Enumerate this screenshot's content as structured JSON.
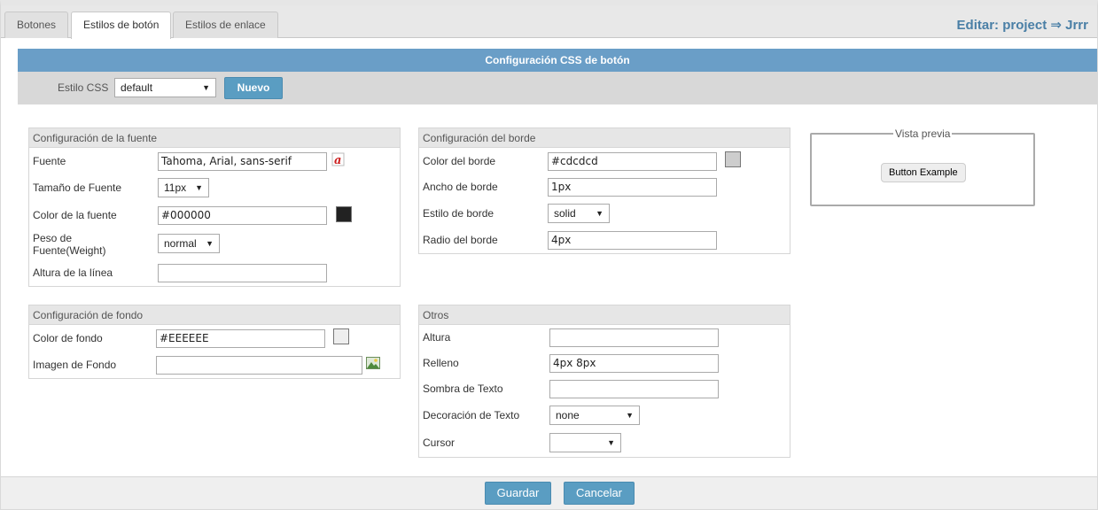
{
  "tabs": [
    {
      "label": "Botones"
    },
    {
      "label": "Estilos de botón"
    },
    {
      "label": "Estilos de enlace"
    }
  ],
  "edit_title": "Editar: project ⇒ Jrrr",
  "header": {
    "title": "Configuración CSS de botón"
  },
  "css_style": {
    "label": "Estilo CSS",
    "selected": "default",
    "new_button": "Nuevo"
  },
  "font_config": {
    "title": "Configuración de la fuente",
    "font_label": "Fuente",
    "font_value": "Tahoma, Arial, sans-serif",
    "size_label": "Tamaño de Fuente",
    "size_value": "11px",
    "color_label": "Color de la fuente",
    "color_value": "#000000",
    "weight_label_1": "Peso de",
    "weight_label_2": "Fuente(Weight)",
    "weight_value": "normal",
    "line_height_label": "Altura de la línea",
    "line_height_value": ""
  },
  "background_config": {
    "title": "Configuración de fondo",
    "color_label": "Color de fondo",
    "color_value": "#EEEEEE",
    "image_label": "Imagen de Fondo",
    "image_value": ""
  },
  "border_config": {
    "title": "Configuración del borde",
    "color_label": "Color del borde",
    "color_value": "#cdcdcd",
    "width_label": "Ancho de borde",
    "width_value": "1px",
    "style_label": "Estilo de borde",
    "style_value": "solid",
    "radius_label": "Radio del borde",
    "radius_value": "4px"
  },
  "others": {
    "title": "Otros",
    "height_label": "Altura",
    "height_value": "",
    "padding_label": "Relleno",
    "padding_value": "4px 8px",
    "text_shadow_label": "Sombra de Texto",
    "text_shadow_value": "",
    "text_decoration_label": "Decoración de Texto",
    "text_decoration_value": "none",
    "cursor_label": "Cursor",
    "cursor_value": ""
  },
  "preview": {
    "legend": "Vista previa",
    "example_label": "Button Example"
  },
  "footer": {
    "save": "Guardar",
    "cancel": "Cancelar"
  },
  "colors": {
    "accent": "#6a9ec7",
    "button_blue": "#5a9dc2",
    "font_swatch": "#222222",
    "background_swatch": "#eeeeee",
    "border_swatch": "#cdcdcd"
  }
}
